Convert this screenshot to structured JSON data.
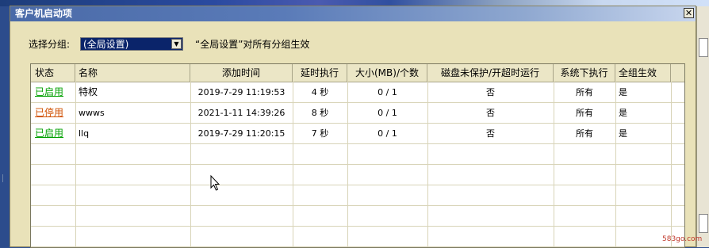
{
  "dialog": {
    "title": "客户机启动项",
    "close_glyph": "✕"
  },
  "group": {
    "label": "选择分组:",
    "selected": "(全局设置)",
    "note": "“全局设置”对所有分组生效"
  },
  "table": {
    "headers": [
      "状态",
      "名称",
      "添加时间",
      "延时执行",
      "大小(MB)/个数",
      "磁盘未保护/开超时运行",
      "系统下执行",
      "全组生效"
    ],
    "rows": [
      {
        "status": "已启用",
        "status_state": "enabled",
        "name": "特权",
        "added": "2019-7-29 11:19:53",
        "delay": "4 秒",
        "size": "0 / 1",
        "unprotected": "否",
        "system": "所有",
        "all_groups": "是"
      },
      {
        "status": "已停用",
        "status_state": "disabled",
        "name": "wwws",
        "added": "2021-1-11 14:39:26",
        "delay": "8 秒",
        "size": "0 / 1",
        "unprotected": "否",
        "system": "所有",
        "all_groups": "是"
      },
      {
        "status": "已启用",
        "status_state": "enabled",
        "name": "llq",
        "added": "2019-7-29 11:20:15",
        "delay": "7 秒",
        "size": "0 / 1",
        "unprotected": "否",
        "system": "所有",
        "all_groups": "是"
      }
    ]
  },
  "colors": {
    "enabled": "#00a000",
    "disabled": "#d05000",
    "selection": "#0a246a",
    "dialog_bg": "#e9e2b9"
  },
  "watermark": "583go.com"
}
